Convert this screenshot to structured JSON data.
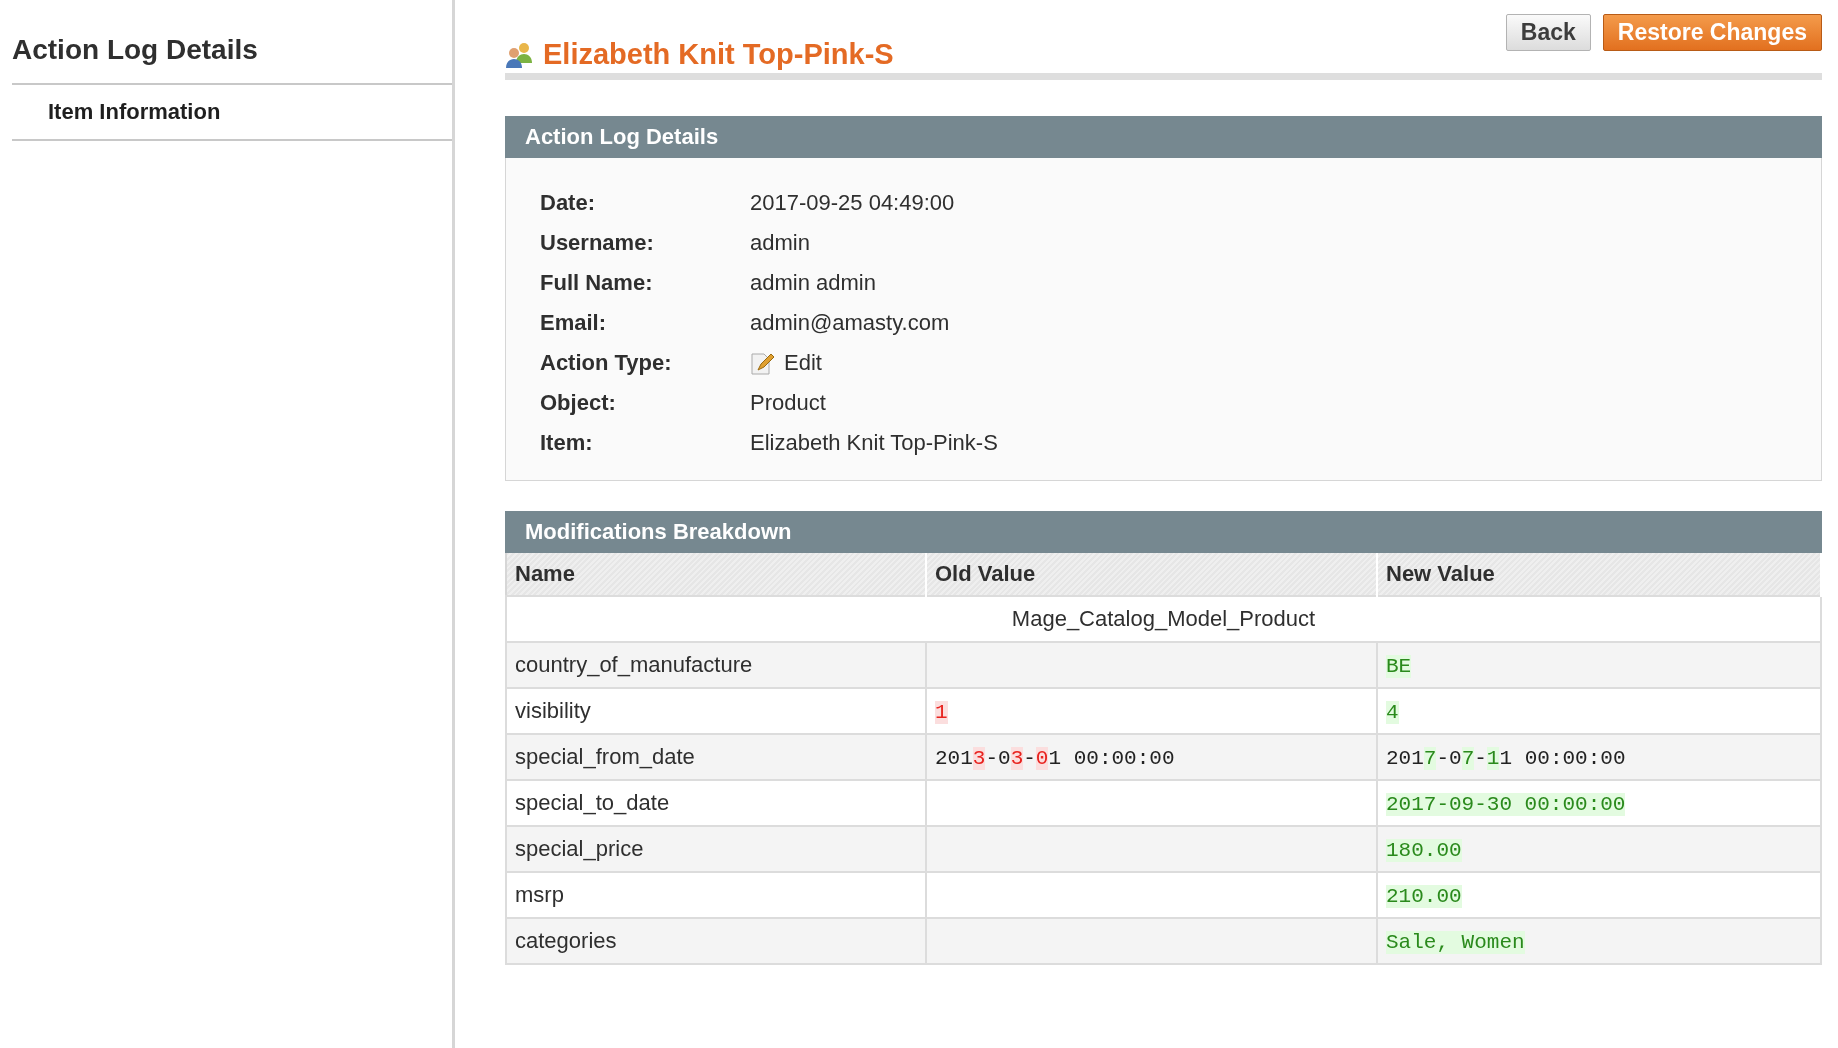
{
  "sidebar": {
    "title": "Action Log Details",
    "items": [
      {
        "label": "Item Information",
        "selected": true
      }
    ]
  },
  "header": {
    "title": "Elizabeth Knit Top-Pink-S",
    "buttons": [
      {
        "label": "Back",
        "kind": "secondary"
      },
      {
        "label": "Restore Changes",
        "kind": "primary"
      }
    ]
  },
  "details": {
    "title": "Action Log Details",
    "fields": [
      {
        "label": "Date:",
        "value": "2017-09-25 04:49:00"
      },
      {
        "label": "Username:",
        "value": "admin"
      },
      {
        "label": "Full Name:",
        "value": "admin admin"
      },
      {
        "label": "Email:",
        "value": "admin@amasty.com"
      },
      {
        "label": "Action Type:",
        "value": "Edit",
        "kind": "edit"
      },
      {
        "label": "Object:",
        "value": "Product"
      },
      {
        "label": "Item:",
        "value": "Elizabeth Knit Top-Pink-S"
      }
    ]
  },
  "breakdown": {
    "title": "Modifications Breakdown",
    "columns": [
      "Name",
      "Old Value",
      "New Value"
    ],
    "group": "Mage_Catalog_Model_Product",
    "rows": [
      {
        "name": "country_of_manufacture",
        "old": [],
        "new": [
          {
            "text": "BE",
            "highlighted": true
          }
        ]
      },
      {
        "name": "visibility",
        "old": [
          {
            "text": "1",
            "highlighted": true
          }
        ],
        "new": [
          {
            "text": "4",
            "highlighted": true
          }
        ]
      },
      {
        "name": "special_from_date",
        "old": [
          {
            "text": "201",
            "highlighted": false
          },
          {
            "text": "3",
            "highlighted": true
          },
          {
            "text": "-0",
            "highlighted": false
          },
          {
            "text": "3",
            "highlighted": true
          },
          {
            "text": "-",
            "highlighted": false
          },
          {
            "text": "0",
            "highlighted": true
          },
          {
            "text": "1 00:00:00",
            "highlighted": false
          }
        ],
        "new": [
          {
            "text": "201",
            "highlighted": false
          },
          {
            "text": "7",
            "highlighted": true
          },
          {
            "text": "-0",
            "highlighted": false
          },
          {
            "text": "7",
            "highlighted": true
          },
          {
            "text": "-",
            "highlighted": false
          },
          {
            "text": "1",
            "highlighted": true
          },
          {
            "text": "1 00:00:00",
            "highlighted": false
          }
        ]
      },
      {
        "name": "special_to_date",
        "old": [],
        "new": [
          {
            "text": "2017-09-30 00:00:00",
            "highlighted": true
          }
        ]
      },
      {
        "name": "special_price",
        "old": [],
        "new": [
          {
            "text": "180.00",
            "highlighted": true
          }
        ]
      },
      {
        "name": "msrp",
        "old": [],
        "new": [
          {
            "text": "210.00",
            "highlighted": true
          }
        ]
      },
      {
        "name": "categories",
        "old": [],
        "new": [
          {
            "text": "Sale, Women",
            "highlighted": true
          }
        ]
      }
    ]
  }
}
